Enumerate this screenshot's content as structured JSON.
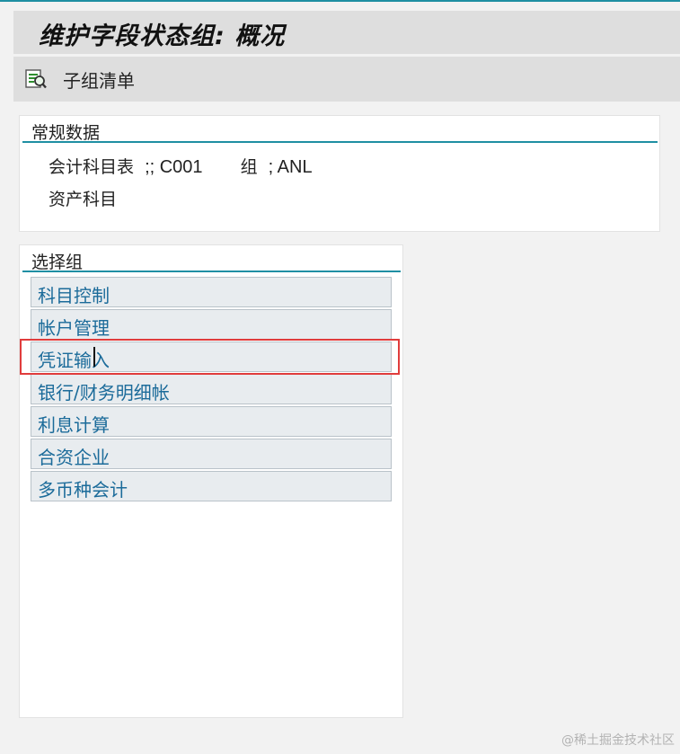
{
  "window": {
    "title": "维护字段状态组: 概况"
  },
  "toolbar": {
    "subgroup_list_label": "子组清单",
    "subgroup_list_icon": "list-search-icon"
  },
  "general": {
    "header": "常规数据",
    "chart_of_accounts_label": "会计科目表",
    "chart_of_accounts_value": ";; C001",
    "group_label": "组",
    "group_value": "; ANL",
    "group_description": "资产科目"
  },
  "select_group": {
    "header": "选择组",
    "items": [
      {
        "label": "科目控制"
      },
      {
        "label": "帐户管理"
      },
      {
        "label": "凭证输入"
      },
      {
        "label": "银行/财务明细帐"
      },
      {
        "label": "利息计算"
      },
      {
        "label": "合资企业"
      },
      {
        "label": "多币种会计"
      }
    ],
    "highlighted_index": 2
  },
  "colors": {
    "accent_line": "#1f8fa3",
    "link_text": "#1b6b9a",
    "highlight": "#e03c3c"
  },
  "watermark": "@稀土掘金技术社区"
}
